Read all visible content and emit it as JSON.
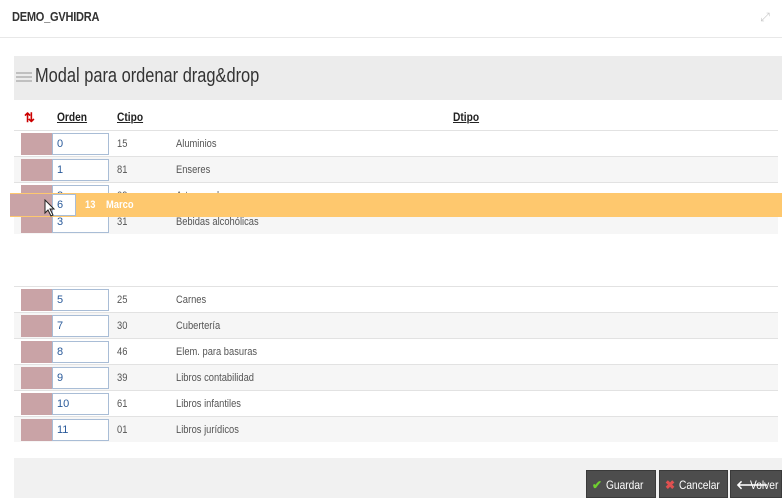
{
  "app": {
    "title": "DEMO_GVHIDRA"
  },
  "modal": {
    "title": "Modal para ordenar drag&drop",
    "columns": {
      "orden": "Orden",
      "ctipo": "Ctipo",
      "dtipo": "Dtipo"
    },
    "rows": [
      {
        "orden": "0",
        "ctipo": "15",
        "dtipo": "Aluminios"
      },
      {
        "orden": "1",
        "ctipo": "81",
        "dtipo": "Enseres"
      },
      {
        "orden": "2",
        "ctipo": "09",
        "dtipo": "Arte mural"
      },
      {
        "orden": "3",
        "ctipo": "31",
        "dtipo": "Bebidas alcohólicas"
      },
      {
        "orden": "5",
        "ctipo": "25",
        "dtipo": "Carnes"
      },
      {
        "orden": "7",
        "ctipo": "30",
        "dtipo": "Cubertería"
      },
      {
        "orden": "8",
        "ctipo": "46",
        "dtipo": "Elem. para basuras"
      },
      {
        "orden": "9",
        "ctipo": "39",
        "dtipo": "Libros contabilidad"
      },
      {
        "orden": "10",
        "ctipo": "61",
        "dtipo": "Libros infantiles"
      },
      {
        "orden": "11",
        "ctipo": "01",
        "dtipo": "Libros jurídicos"
      }
    ],
    "dragging_row": {
      "orden": "6",
      "ctipo": "13",
      "dtipo": "Marco"
    }
  },
  "buttons": {
    "guardar": "Guardar",
    "cancelar": "Cancelar",
    "volver": "Volver"
  },
  "icons": {
    "sort": "sort-arrows-icon",
    "menu": "list-icon",
    "resize": "expand-icon",
    "guardar": "check-icon",
    "cancelar": "x-icon",
    "volver": "arrow-left-icon"
  },
  "colors": {
    "drag_highlight": "#fec86e",
    "handle": "#c9a3a6",
    "sort_icon": "#cc0000",
    "button_bg": "#4d4d4d",
    "check": "#6fcf2f",
    "cancel": "#e05050"
  }
}
